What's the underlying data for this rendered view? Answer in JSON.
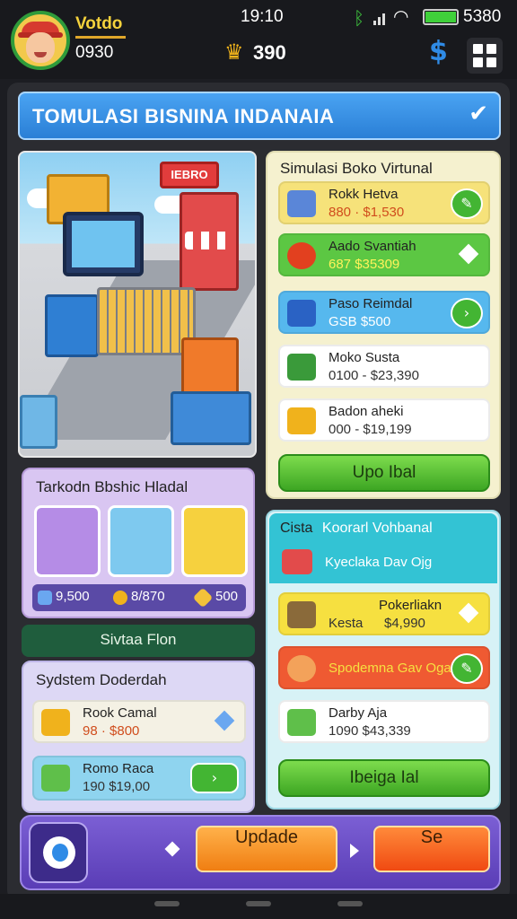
{
  "status": {
    "time": "19:10",
    "battery": "5380"
  },
  "player": {
    "name": "Votdo",
    "coins": "0930"
  },
  "top": {
    "crown_value": "390",
    "dollar_glyph": "$"
  },
  "banner": {
    "title": "TOMULASI BISNINA INDANAIA"
  },
  "shop_list": {
    "title": "Simulasi Boko Virtunal",
    "items": [
      {
        "name": "Rokk Hetva",
        "price": "880 · $1,530",
        "color": "#f6e27a",
        "icon": "book-icon"
      },
      {
        "name": "Aado Svantiah",
        "price": "687 $35309",
        "color": "#5cc743",
        "icon": "apple-icon"
      },
      {
        "name": "Paso Reimdal",
        "price": "GSB $500",
        "color": "#56b8ee",
        "icon": "bag-icon"
      },
      {
        "name": "Moko Susta",
        "price": "0100 - $23,390",
        "color": "#ffffff",
        "icon": "gift-icon"
      },
      {
        "name": "Badon aheki",
        "price": "000 - $19,199",
        "color": "#ffffff",
        "icon": "box-icon"
      }
    ],
    "button": "Upo Ibal"
  },
  "trending": {
    "title": "Tarkodn Bbshic Hladal",
    "stats": [
      "9,500",
      "8/870",
      "500"
    ]
  },
  "system_label": "Sivtaa Flon",
  "system": {
    "title": "Sydstem Doderdah",
    "items": [
      {
        "name": "Rook Camal",
        "price": "98 · $800"
      },
      {
        "name": "Romo Raca",
        "price": "190  $19,00"
      }
    ]
  },
  "catalog": {
    "title": "Cista",
    "title_sub": "Koorarl Vohbanal",
    "header_row": "Kyeclaka Dav Ojg",
    "items": [
      {
        "name": "Pokerliakn",
        "sub": "Kesta",
        "price": "$4,990"
      },
      {
        "name": "Spodemna Gav Oga"
      },
      {
        "name": "Darby Aja",
        "price": "1090 $43,339"
      }
    ],
    "button": "Ibeiga Ial"
  },
  "actions": {
    "update": "Updade",
    "se": "Se"
  }
}
